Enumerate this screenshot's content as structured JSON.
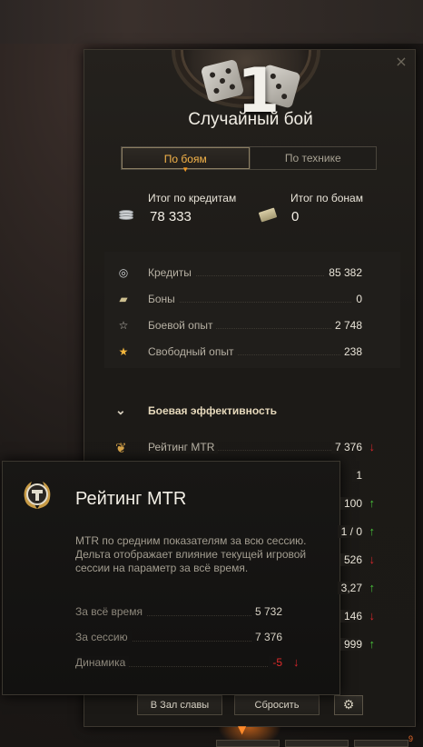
{
  "header": {
    "rank_number": "1",
    "battle_type": "Случайный бой",
    "close_icon": "×"
  },
  "tabs": [
    {
      "label": "По боям",
      "active": true
    },
    {
      "label": "По технике",
      "active": false
    }
  ],
  "totals": {
    "credits_label": "Итог по кредитам",
    "credits_value": "78 333",
    "bonds_label": "Итог по бонам",
    "bonds_value": "0"
  },
  "stats": [
    {
      "icon": "credits-icon",
      "label": "Кредиты",
      "value": "85 382"
    },
    {
      "icon": "bonds-icon",
      "label": "Боны",
      "value": "0"
    },
    {
      "icon": "combat-xp-icon",
      "label": "Боевой опыт",
      "value": "2 748"
    },
    {
      "icon": "free-xp-icon",
      "label": "Свободный опыт",
      "value": "238"
    }
  ],
  "efficiency": {
    "title": "Боевая эффективность",
    "rows": [
      {
        "label": "Рейтинг MTR",
        "value": "7 376",
        "trend": "down",
        "arrow": "↓"
      },
      {
        "label": "",
        "value": "1",
        "trend": "none",
        "arrow": ""
      },
      {
        "label": "",
        "value": "100",
        "trend": "up",
        "arrow": "↑"
      },
      {
        "label": "",
        "value": "1 / 0",
        "trend": "up",
        "arrow": "↑"
      },
      {
        "label": "",
        "value": "526",
        "trend": "down",
        "arrow": "↓"
      },
      {
        "label": "",
        "value": "3,27",
        "trend": "up",
        "arrow": "↑"
      },
      {
        "label": "",
        "value": "146",
        "trend": "down",
        "arrow": "↓"
      },
      {
        "label": "",
        "value": "999",
        "trend": "up",
        "arrow": "↑"
      }
    ]
  },
  "footer": {
    "hall_of_fame_label": "В Зал славы",
    "reset_label": "Сбросить",
    "settings_icon": "⚙",
    "corner_badge": "9"
  },
  "tooltip": {
    "title": "Рейтинг MTR",
    "description": "MTR по средним показателям за всю сессию. Дельта отображает влияние текущей игровой сессии на параметр за всё время.",
    "rows": [
      {
        "label": "За всё время",
        "value": "5 732"
      },
      {
        "label": "За сессию",
        "value": "7 376"
      },
      {
        "label": "Динамика",
        "value": "-5",
        "arrow": "↓"
      }
    ]
  },
  "colors": {
    "accent_orange": "#f5b44a",
    "trend_up": "#49c43b",
    "trend_down": "#d8262b"
  }
}
